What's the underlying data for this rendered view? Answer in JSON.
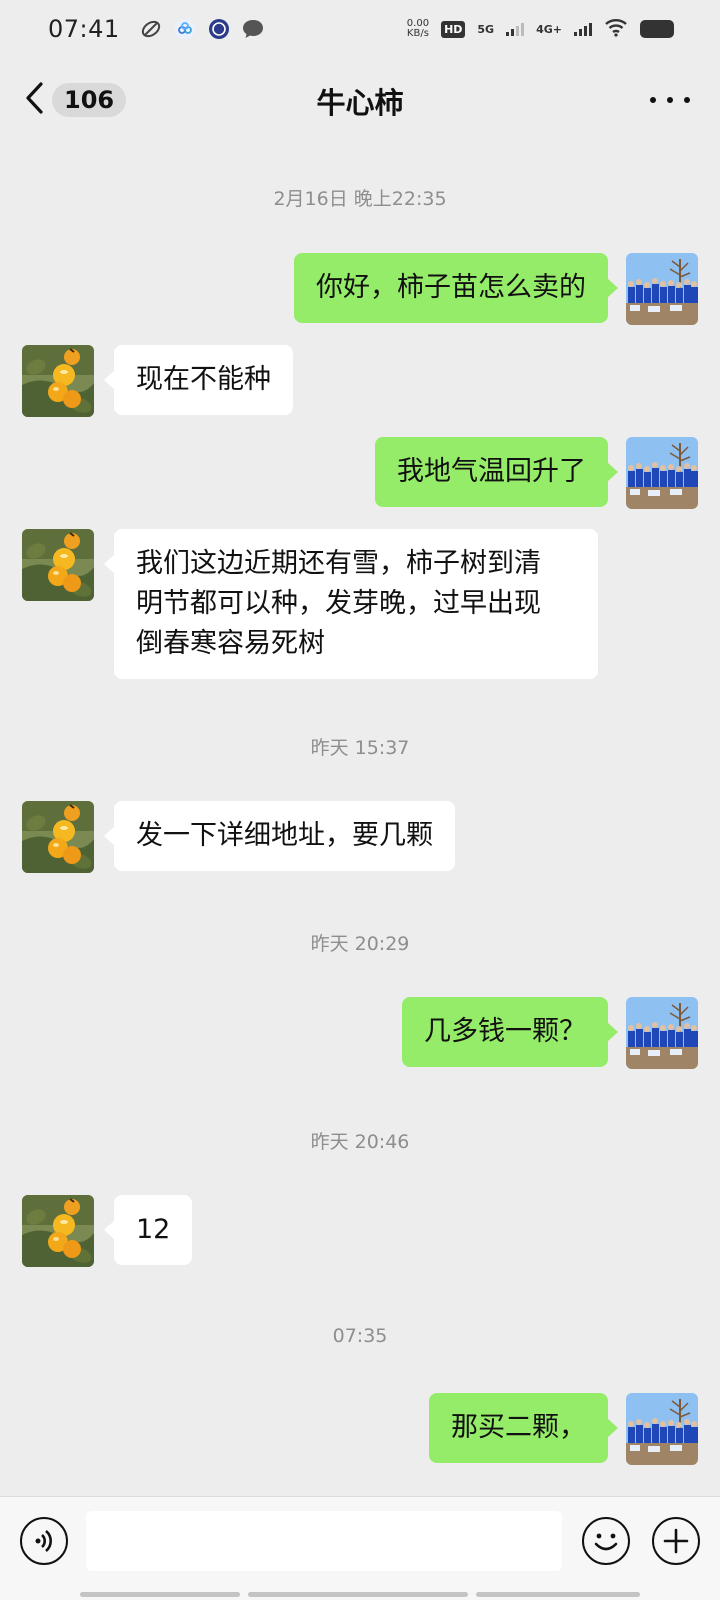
{
  "status_bar": {
    "time": "07:41",
    "net_speed_value": "0.00",
    "net_speed_unit": "KB/s",
    "hd_label": "HD",
    "sim1_label": "5G",
    "sim2_label": "4G+"
  },
  "header": {
    "back_count": "106",
    "title": "牛心柿"
  },
  "messages": [
    {
      "type": "timestamp",
      "text": "2月16日 晚上22:35"
    },
    {
      "type": "message",
      "side": "right",
      "text": "你好，柿子苗怎么卖的"
    },
    {
      "type": "message",
      "side": "left",
      "text": "现在不能种"
    },
    {
      "type": "message",
      "side": "right",
      "text": "我地气温回升了"
    },
    {
      "type": "message",
      "side": "left",
      "lines": [
        "我们这边近期还有雪，柿子树到清",
        "明节都可以种，发芽晚，过早出现",
        "倒春寒容易死树"
      ]
    },
    {
      "type": "timestamp",
      "text": "昨天 15:37"
    },
    {
      "type": "message",
      "side": "left",
      "text": "发一下详细地址，要几颗"
    },
    {
      "type": "timestamp",
      "text": "昨天 20:29"
    },
    {
      "type": "message",
      "side": "right",
      "text": "几多钱一颗？"
    },
    {
      "type": "timestamp",
      "text": "昨天 20:46"
    },
    {
      "type": "message",
      "side": "left",
      "text": "12"
    },
    {
      "type": "timestamp",
      "text": "07:35"
    },
    {
      "type": "message",
      "side": "right",
      "text": "那买二颗，"
    }
  ],
  "input": {
    "value": "",
    "placeholder": ""
  },
  "colors": {
    "background": "#ededed",
    "sent_bubble": "#95ec69",
    "received_bubble": "#ffffff",
    "timestamp_text": "#8e8e8e"
  },
  "icons": {
    "back": "chevron-left-icon",
    "more": "more-dots-icon",
    "voice": "voice-icon",
    "emoji": "emoji-icon",
    "plus": "plus-icon",
    "contact_avatar": "persimmon-photo-avatar",
    "my_avatar": "group-photo-avatar"
  }
}
